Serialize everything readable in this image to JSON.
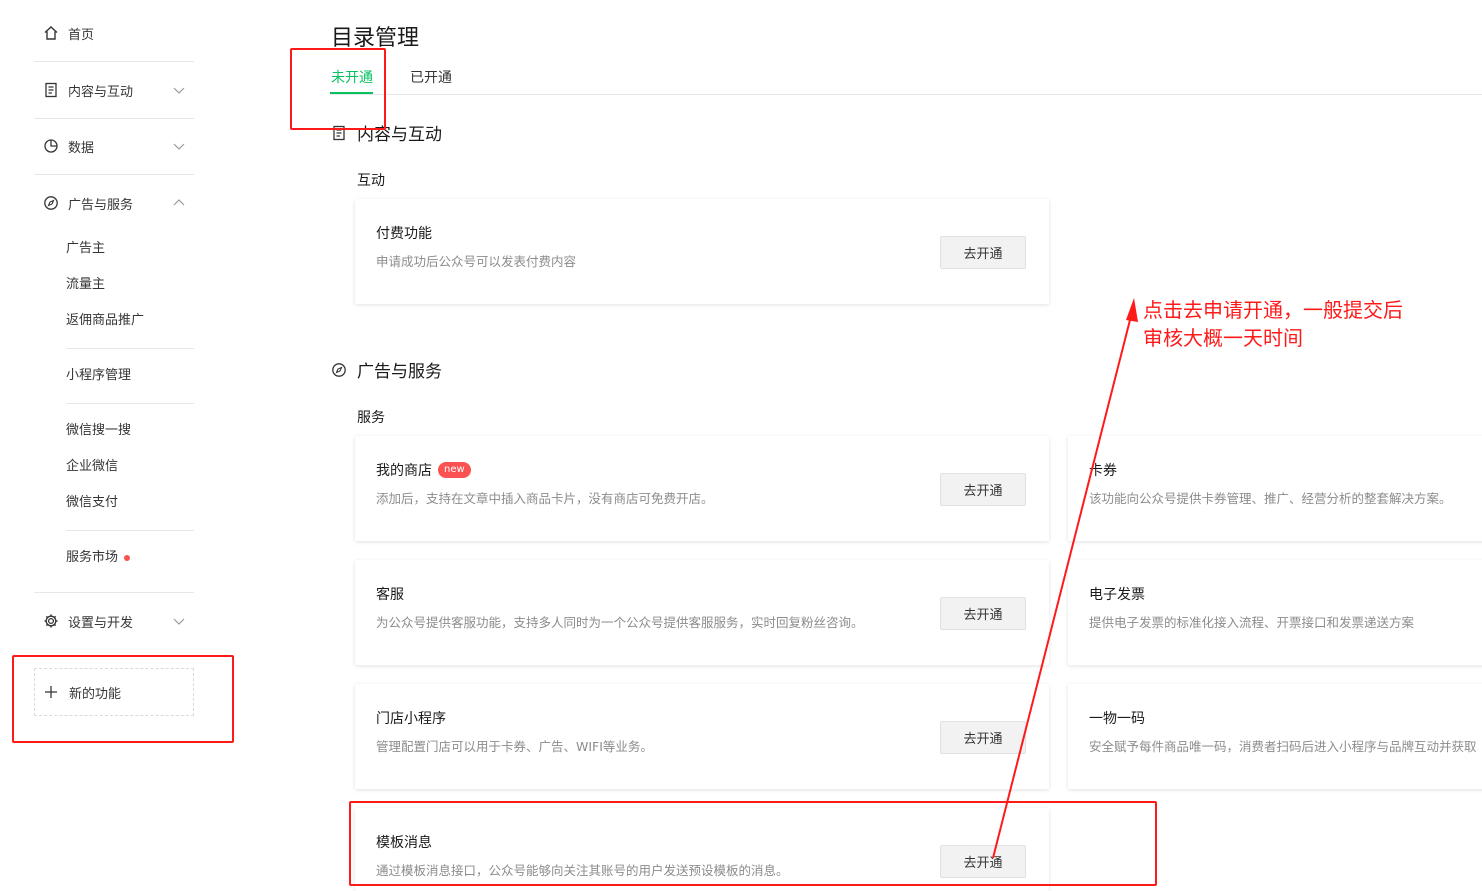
{
  "sidebar": {
    "home": "首页",
    "content": "内容与互动",
    "data": "数据",
    "ads": "广告与服务",
    "ads_items": [
      "广告主",
      "流量主",
      "返佣商品推广"
    ],
    "mini_program": "小程序管理",
    "wechat_items": [
      "微信搜一搜",
      "企业微信",
      "微信支付"
    ],
    "market": "服务市场",
    "settings": "设置与开发",
    "new_func": "新的功能"
  },
  "main": {
    "title": "目录管理",
    "tabs": [
      "未开通",
      "已开通"
    ],
    "section_content": "内容与互动",
    "group_interact": "互动",
    "section_ads": "广告与服务",
    "group_service": "服务",
    "badge_new": "new",
    "cards": [
      {
        "title": "付费功能",
        "desc": "申请成功后公众号可以发表付费内容",
        "button": "去开通"
      },
      {
        "title": "我的商店",
        "desc": "添加后，支持在文章中插入商品卡片，没有商店可免费开店。",
        "button": "去开通"
      },
      {
        "title": "卡券",
        "desc": "该功能向公众号提供卡券管理、推广、经营分析的整套解决方案。"
      },
      {
        "title": "客服",
        "desc": "为公众号提供客服功能，支持多人同时为一个公众号提供客服服务，实时回复粉丝咨询。",
        "button": "去开通"
      },
      {
        "title": "电子发票",
        "desc": "提供电子发票的标准化接入流程、开票接口和发票递送方案"
      },
      {
        "title": "门店小程序",
        "desc": "管理配置门店可以用于卡券、广告、WIFI等业务。",
        "button": "去开通"
      },
      {
        "title": "一物一码",
        "desc": "安全赋予每件商品唯一码，消费者扫码后进入小程序与品牌互动并获取"
      },
      {
        "title": "模板消息",
        "desc": "通过模板消息接口，公众号能够向关注其账号的用户发送预设模板的消息。",
        "button": "去开通"
      }
    ]
  },
  "annotation": {
    "line1": "点击去申请开通，一般提交后",
    "line2": "审核大概一天时间"
  },
  "colors": {
    "accent": "#07c160",
    "annotation": "#ff1a1a",
    "badge": "#fa5151"
  }
}
